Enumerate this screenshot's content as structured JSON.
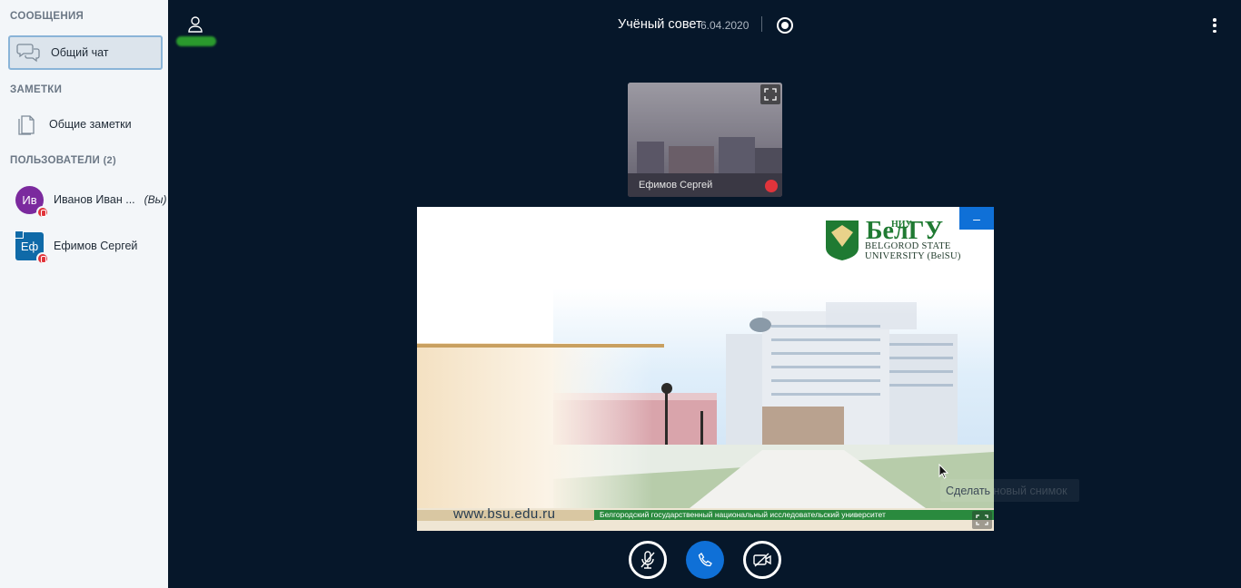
{
  "sidebar": {
    "messages_title": "СООБЩЕНИЯ",
    "public_chat": "Общий чат",
    "notes_title": "ЗАМЕТКИ",
    "shared_notes": "Общие заметки",
    "users_title": "ПОЛЬЗОВАТЕЛИ",
    "users_count": "(2)",
    "users": [
      {
        "initials": "Ив",
        "name": "Иванов Иван ...",
        "you_label": "(Вы)",
        "avatar_color": "#7b2a9e"
      },
      {
        "initials": "Еф",
        "name": "Ефимов Сергей",
        "you_label": "",
        "avatar_color": "#0f6aa8"
      }
    ]
  },
  "header": {
    "title": "Учёный совет",
    "date": "6.04.2020"
  },
  "webcam": {
    "name": "Ефимов Сергей"
  },
  "presentation": {
    "logo_small": "НИУ",
    "logo_big": "БелГУ",
    "logo_sub1": "BELGOROD STATE",
    "logo_sub2": "UNIVERSITY (BelSU)",
    "url": "www.bsu.edu.ru",
    "university_line": "Белгородский государственный национальный исследовательский университет",
    "minimize_label": "–"
  },
  "tooltip": {
    "text": "Сделать новый снимок"
  },
  "colors": {
    "background": "#06172a",
    "accent": "#0f70d7",
    "mute": "#e0343b"
  }
}
